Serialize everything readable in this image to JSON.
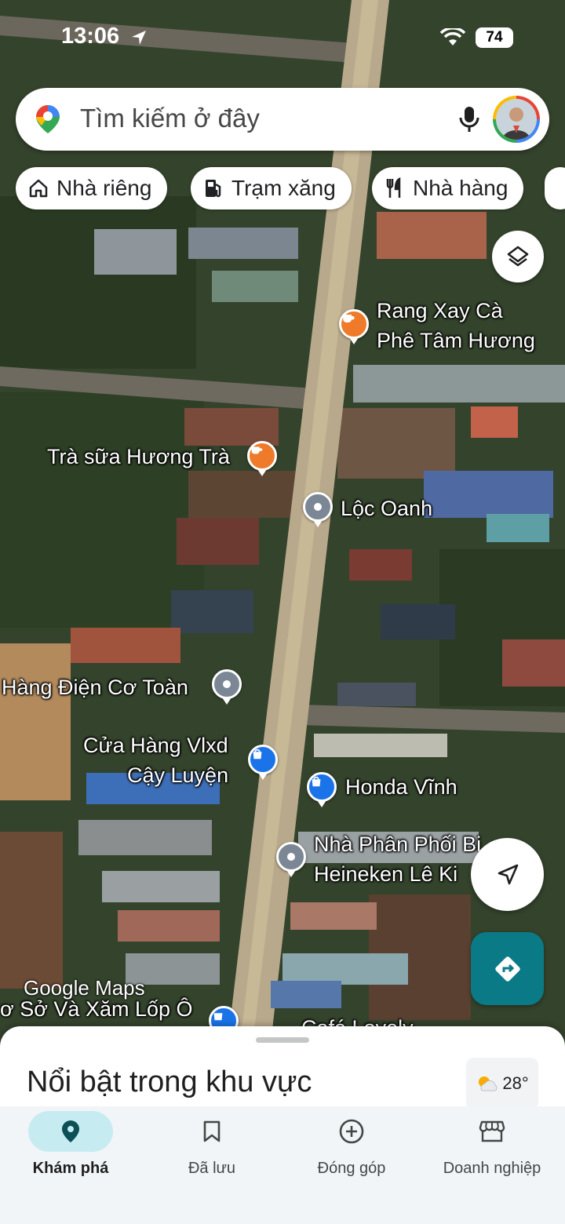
{
  "status_bar": {
    "time": "13:06",
    "battery": "74"
  },
  "search": {
    "placeholder": "Tìm kiếm ở đây"
  },
  "chips": [
    {
      "label": "Nhà riêng",
      "icon": "home-icon"
    },
    {
      "label": "Trạm xăng",
      "icon": "gas-station-icon"
    },
    {
      "label": "Nhà hàng",
      "icon": "restaurant-icon"
    }
  ],
  "places": {
    "rang_xay_line1": "Rang Xay Cà",
    "rang_xay_line2": "Phê Tâm Hương",
    "tra_sua": "Trà sữa Hương Trà",
    "loc_oanh": "Lộc Oanh",
    "hang_dien": "Hàng Điện Cơ Toàn",
    "cua_hang_line1": "Cửa Hàng Vlxd",
    "cua_hang_line2": "Cậy Luyện",
    "honda": "Honda Vĩnh",
    "nha_phan_phoi_line1": "Nhà Phân Phối Bi",
    "nha_phan_phoi_line2": "Heineken Lê Ki",
    "co_so": "ơ Sở Và Xăm Lốp Ô",
    "cafe": "Café Lovely"
  },
  "watermark": "Google Maps",
  "sheet": {
    "title": "Nổi bật trong khu vực",
    "temperature": "28°"
  },
  "nav": [
    {
      "label": "Khám phá",
      "icon": "explore-pin-icon",
      "active": true
    },
    {
      "label": "Đã lưu",
      "icon": "bookmark-icon",
      "active": false
    },
    {
      "label": "Đóng góp",
      "icon": "add-circle-icon",
      "active": false
    },
    {
      "label": "Doanh nghiệp",
      "icon": "storefront-icon",
      "active": false
    }
  ],
  "colors": {
    "accent": "#0b7a87",
    "nav_active_bg": "#c6ecf2",
    "poi_orange": "#ee7a2a",
    "poi_blue": "#1a73e8",
    "poi_gray": "#7b8794"
  }
}
